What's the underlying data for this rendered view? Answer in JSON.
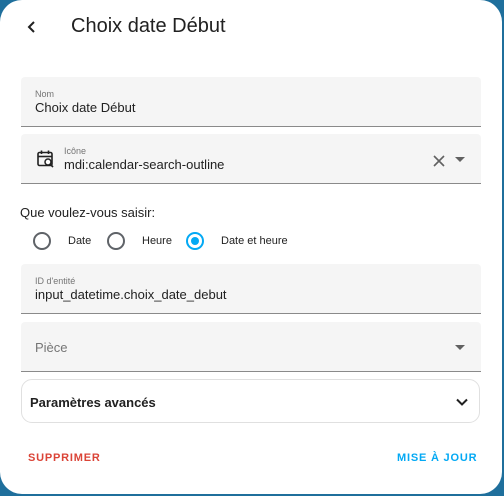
{
  "dialog": {
    "title": "Choix date Début"
  },
  "name_field": {
    "label": "Nom",
    "value": "Choix date Début"
  },
  "icon_field": {
    "label": "Icône",
    "value": "mdi:calendar-search-outline",
    "leading_icon": "calendar-search-icon"
  },
  "mode": {
    "question": "Que voulez-vous saisir:",
    "options": [
      {
        "label": "Date",
        "checked": false
      },
      {
        "label": "Heure",
        "checked": false
      },
      {
        "label": "Date et heure",
        "checked": true
      }
    ]
  },
  "entity_field": {
    "label": "ID d'entité",
    "value": "input_datetime.choix_date_debut"
  },
  "area_field": {
    "placeholder": "Pièce"
  },
  "advanced": {
    "label": "Paramètres avancés"
  },
  "actions": {
    "delete_label": "SUPPRIMER",
    "update_label": "MISE À JOUR"
  },
  "colors": {
    "accent": "#03a9f4",
    "danger": "#db4437",
    "field_bg": "#f5f5f5"
  }
}
